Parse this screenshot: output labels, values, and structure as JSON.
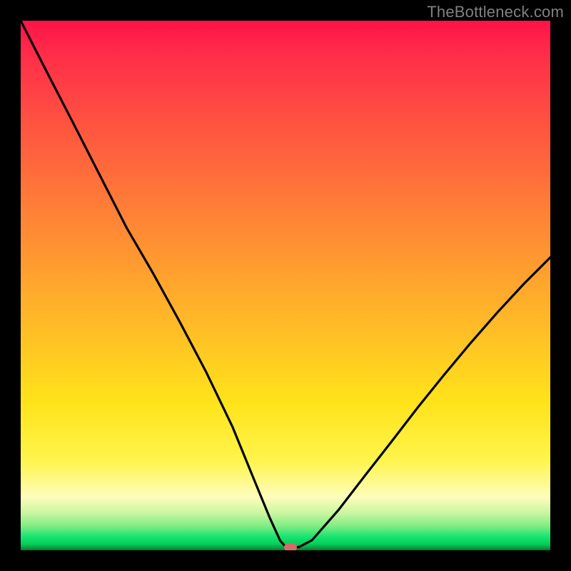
{
  "watermark": "TheBottleneck.com",
  "colors": {
    "curve_stroke": "#000000",
    "marker_fill": "#d46a6a"
  },
  "chart_data": {
    "type": "line",
    "title": "",
    "xlabel": "",
    "ylabel": "",
    "xlim": [
      0,
      100
    ],
    "ylim": [
      0,
      100
    ],
    "grid": false,
    "legend": false,
    "x": [
      0,
      5,
      10,
      15,
      20,
      25,
      30,
      35,
      40,
      44,
      47,
      49,
      50,
      51,
      52.5,
      55,
      60,
      65,
      70,
      75,
      80,
      85,
      90,
      95,
      100
    ],
    "values": [
      100,
      90.2,
      80.5,
      70.7,
      60.9,
      52.3,
      43.2,
      33.7,
      23.3,
      13.5,
      6.2,
      1.8,
      0.7,
      0.5,
      0.6,
      1.9,
      7.6,
      14.1,
      20.5,
      27.0,
      33.2,
      39.2,
      44.9,
      50.3,
      55.3
    ],
    "marker": {
      "x": 51,
      "y": 0.5
    },
    "annotations": []
  }
}
